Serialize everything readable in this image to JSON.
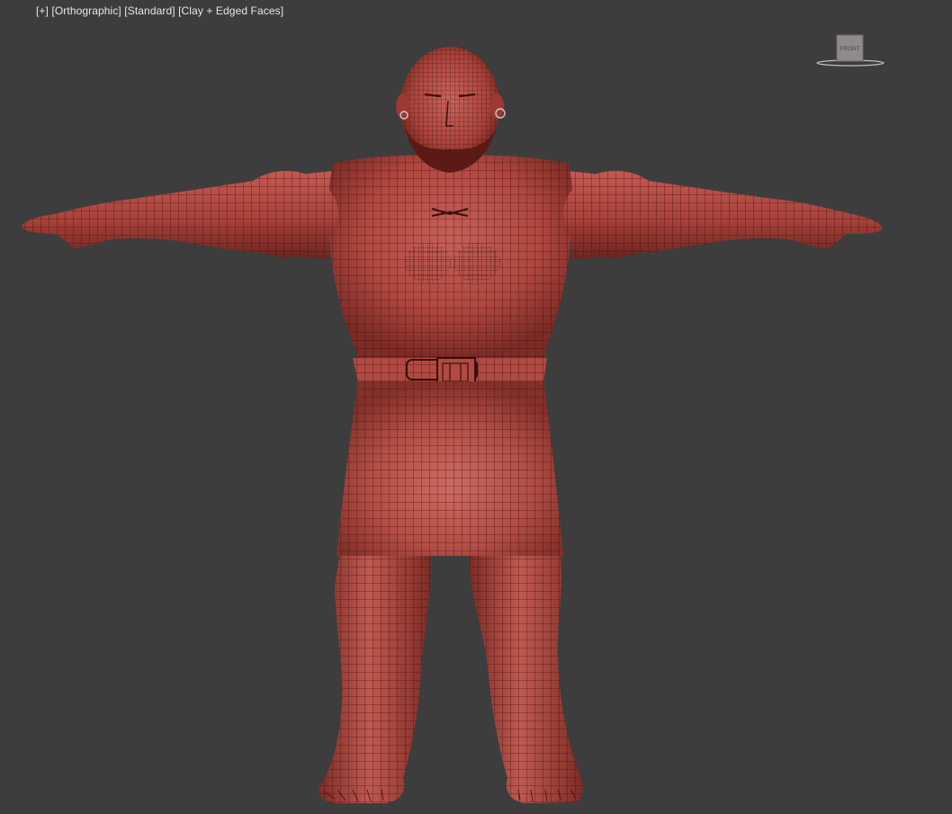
{
  "viewport": {
    "menu_label": "[+]",
    "view_label": "[Orthographic]",
    "shading_label": "[Standard]",
    "mode_label": "[Clay + Edged Faces]"
  },
  "viewcube": {
    "face_label": "FRONT"
  },
  "colors": {
    "background": "#3d3d3d",
    "clay": "#b34a43",
    "wire": "#3a0e0c"
  }
}
